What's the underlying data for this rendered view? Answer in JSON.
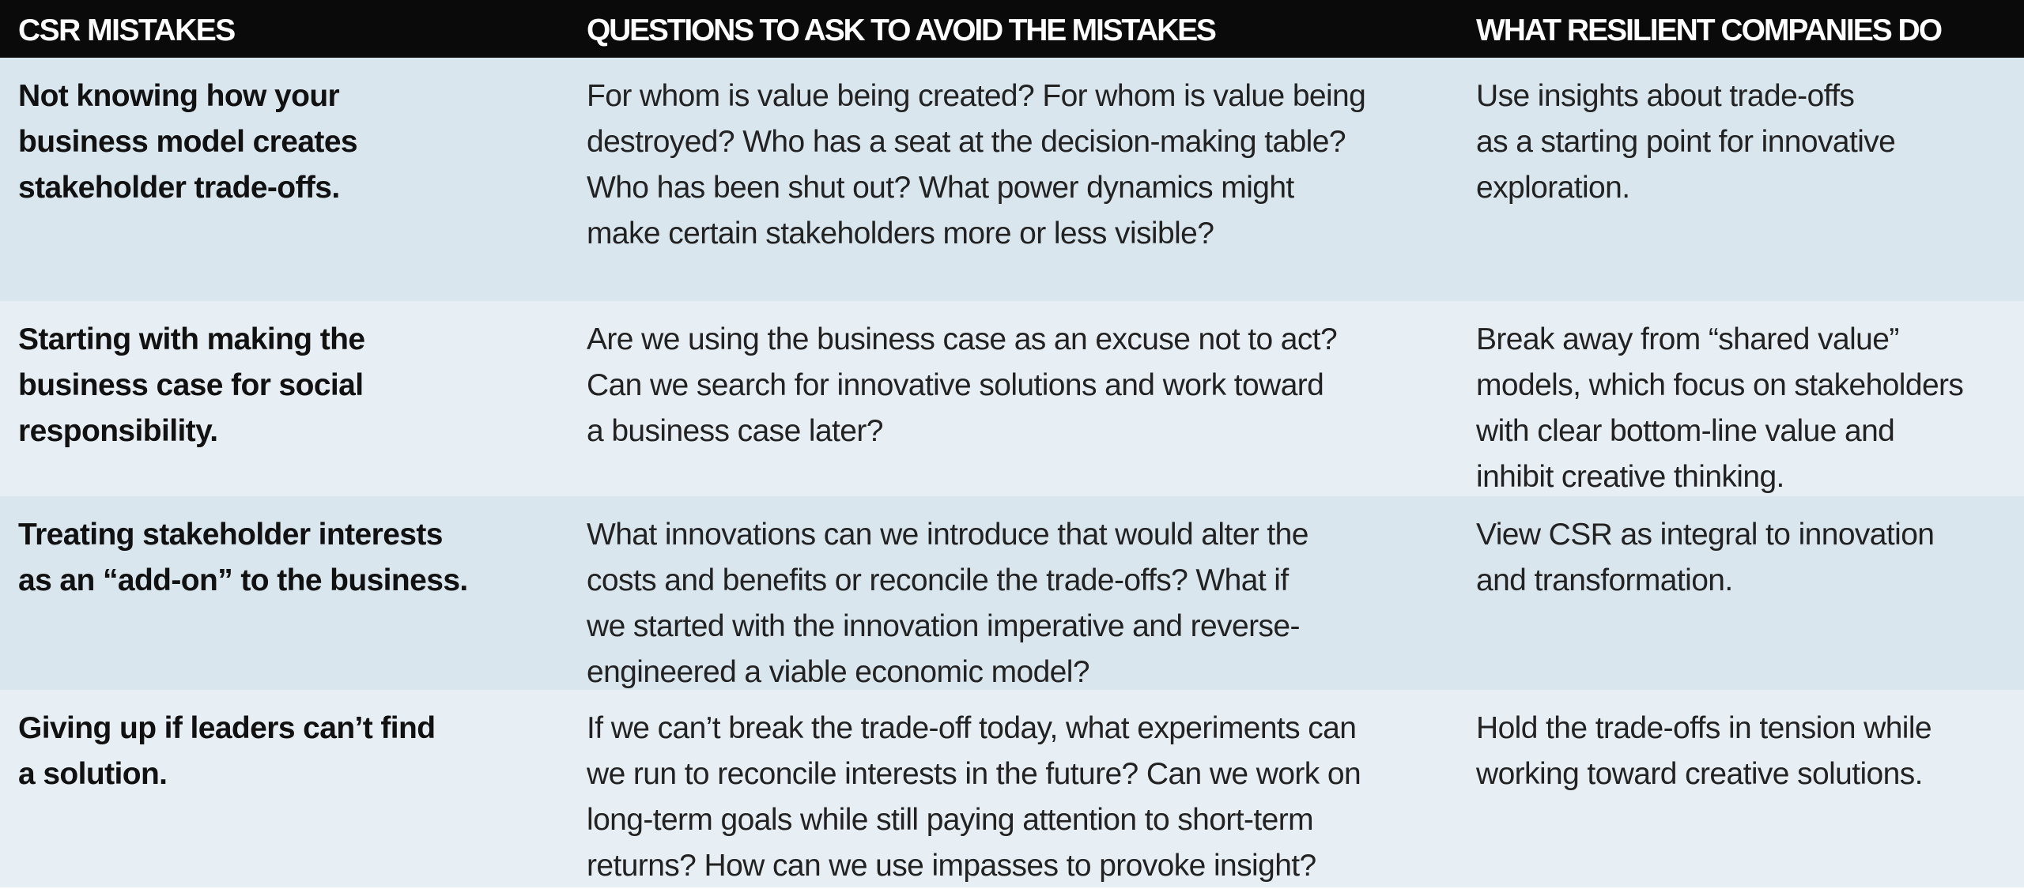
{
  "table": {
    "headers": [
      "CSR MISTAKES",
      "QUESTIONS TO ASK TO AVOID THE MISTAKES",
      "WHAT RESILIENT COMPANIES DO"
    ],
    "rows": [
      {
        "mistake": [
          "Not knowing how your",
          "business model creates",
          "stakeholder trade-offs."
        ],
        "questions": [
          "For whom is value being created? For whom is value being",
          "destroyed? Who has a seat at the decision-making table?",
          "Who has been shut out? What power dynamics might",
          "make certain stakeholders more or less visible?"
        ],
        "action": [
          "Use insights about trade-offs",
          "as a starting point for innovative",
          "exploration."
        ]
      },
      {
        "mistake": [
          "Starting with making the",
          "business case for social",
          "responsibility."
        ],
        "questions": [
          "Are we using the business case as an excuse not to act?",
          "Can we search for innovative solutions and work toward",
          "a business case later?"
        ],
        "action": [
          "Break away from “shared value”",
          "models, which focus on stakeholders",
          "with clear bottom-line value and",
          "inhibit creative thinking."
        ]
      },
      {
        "mistake": [
          "Treating stakeholder interests",
          "as an “add-on” to the business."
        ],
        "questions": [
          "What innovations can we introduce that would alter the",
          "costs and benefits or reconcile the trade-offs? What if",
          "we started with the innovation imperative and reverse-",
          "engineered a viable economic model?"
        ],
        "action": [
          "View CSR as integral to innovation",
          "and transformation."
        ]
      },
      {
        "mistake": [
          "Giving up if leaders can’t find",
          "a solution."
        ],
        "questions": [
          "If we can’t break the trade-off today, what experiments can",
          "we run to reconcile interests in the future? Can we work on",
          "long-term goals while still paying attention to short-term",
          "returns? How can we use impasses to provoke insight?"
        ],
        "action": [
          "Hold the trade-offs in tension while",
          "working toward creative solutions."
        ]
      }
    ]
  }
}
